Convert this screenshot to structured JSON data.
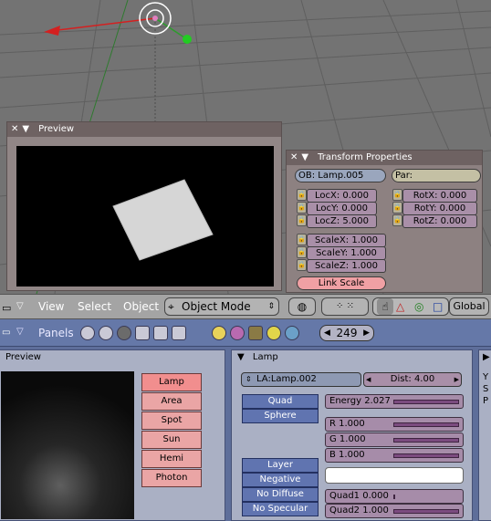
{
  "preview_float": {
    "title": "Preview"
  },
  "transform": {
    "title": "Transform Properties",
    "ob": "OB: Lamp.005",
    "par": "Par:",
    "loc": [
      "LocX: 0.000",
      "LocY: 0.000",
      "LocZ: 5.000"
    ],
    "rot": [
      "RotX: 0.000",
      "RotY: 0.000",
      "RotZ: 0.000"
    ],
    "scale": [
      "ScaleX: 1.000",
      "ScaleY: 1.000",
      "ScaleZ: 1.000"
    ],
    "link_scale": "Link Scale"
  },
  "header3d": {
    "menus": [
      "View",
      "Select",
      "Object"
    ],
    "mode": "Object Mode",
    "orientation": "Global"
  },
  "buttons_header": {
    "panels_label": "Panels",
    "frame": "249"
  },
  "preview_panel": {
    "title": "Preview",
    "types": [
      "Lamp",
      "Area",
      "Spot",
      "Sun",
      "Hemi",
      "Photon"
    ]
  },
  "lamp_panel": {
    "title": "Lamp",
    "datablock": "LA:Lamp.002",
    "dist": "Dist: 4.00",
    "quad": "Quad",
    "sphere": "Sphere",
    "energy": "Energy 2.027",
    "r": "R 1.000",
    "g": "G 1.000",
    "b": "B 1.000",
    "layer": "Layer",
    "negative": "Negative",
    "no_diffuse": "No Diffuse",
    "no_specular": "No Specular",
    "quad1": "Quad1 0.000",
    "quad2": "Quad2 1.000"
  },
  "right_panel_letters": [
    "Y",
    "S",
    "P"
  ]
}
